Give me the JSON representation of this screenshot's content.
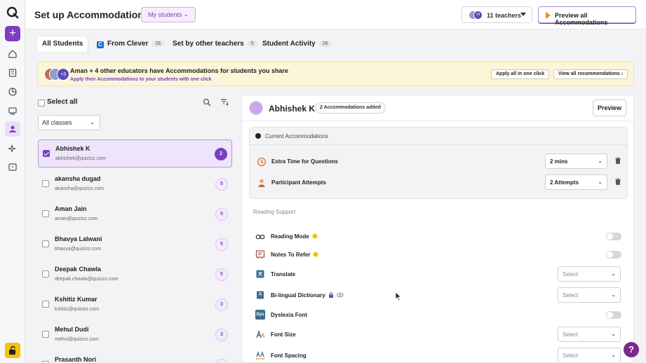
{
  "header": {
    "title": "Set up Accommodations for",
    "students_dropdown": "My students",
    "teachers_avatar_badge": "+9",
    "teachers_label": "11 teachers",
    "preview_all": "Preview all Accommodations"
  },
  "tabs": [
    {
      "label": "All Students",
      "count": ""
    },
    {
      "label": "From Clever",
      "count": "26"
    },
    {
      "label": "Set by other teachers",
      "count": "5"
    },
    {
      "label": "Student Activity",
      "count": "26"
    }
  ],
  "banner": {
    "badge": "+3",
    "title": "Aman + 4 other educators have Accommodations for students you share",
    "subtitle": "Apply their Accommodations to your students with one click",
    "apply_all": "Apply all in one click",
    "view_all": "View all recommendations ›"
  },
  "list": {
    "select_all": "Select all",
    "classes_dropdown": "All classes",
    "students": [
      {
        "name": "Abhishek K",
        "email": "abhishek@quizizz.com",
        "count": "2",
        "checked": true
      },
      {
        "name": "akansha dugad",
        "email": "akansha@quizizz.com",
        "count": "5",
        "checked": false
      },
      {
        "name": "Aman Jain",
        "email": "aman@quizizz.com",
        "count": "5",
        "checked": false
      },
      {
        "name": "Bhavya Lalwani",
        "email": "bhavya@quizizz.com",
        "count": "5",
        "checked": false
      },
      {
        "name": "Deepak Chawla",
        "email": "deepak.chawla@quizizz.com",
        "count": "5",
        "checked": false
      },
      {
        "name": "Kshitiz Kumar",
        "email": "kshitiz@quizizz.com",
        "count": "3",
        "checked": false
      },
      {
        "name": "Mehul Dudi",
        "email": "mehul@quizizz.com",
        "count": "3",
        "checked": false
      },
      {
        "name": "Prasanth Nori",
        "email": "",
        "count": "",
        "checked": false
      }
    ]
  },
  "detail": {
    "student_name": "Abhishek K",
    "added_badge": "2 Accommodations added",
    "preview": "Preview",
    "current_title": "Current Accommodations",
    "current": [
      {
        "label": "Extra Time for Questions",
        "value": "2 mins",
        "icon": "clock-icon"
      },
      {
        "label": "Participant Attempts",
        "value": "2 Attempts",
        "icon": "person-icon"
      }
    ],
    "reading_title": "Reading Support",
    "options": [
      {
        "label": "Reading Mode",
        "control": "toggle",
        "icon": "glasses-icon"
      },
      {
        "label": "Notes To Refer",
        "control": "toggle",
        "icon": "notes-icon"
      },
      {
        "label": "Translate",
        "control": "select",
        "value": "Select",
        "icon": "translate-icon"
      },
      {
        "label": "Bi-lingual Dictionary",
        "control": "select",
        "value": "Select",
        "icon": "dictionary-icon"
      },
      {
        "label": "Dyslexia Font",
        "control": "toggle",
        "icon": "dyslexia-font-icon",
        "icon_text": "Dys"
      },
      {
        "label": "Font Size",
        "control": "select",
        "value": "Select",
        "icon": "font-size-icon"
      },
      {
        "label": "Font Spacing",
        "control": "select",
        "value": "Select",
        "icon": "font-spacing-icon"
      }
    ]
  },
  "help": "?",
  "colors": {
    "accent": "#7b3fc4",
    "banner_bg": "#fdf5d8",
    "lock": "#f4c20d"
  }
}
